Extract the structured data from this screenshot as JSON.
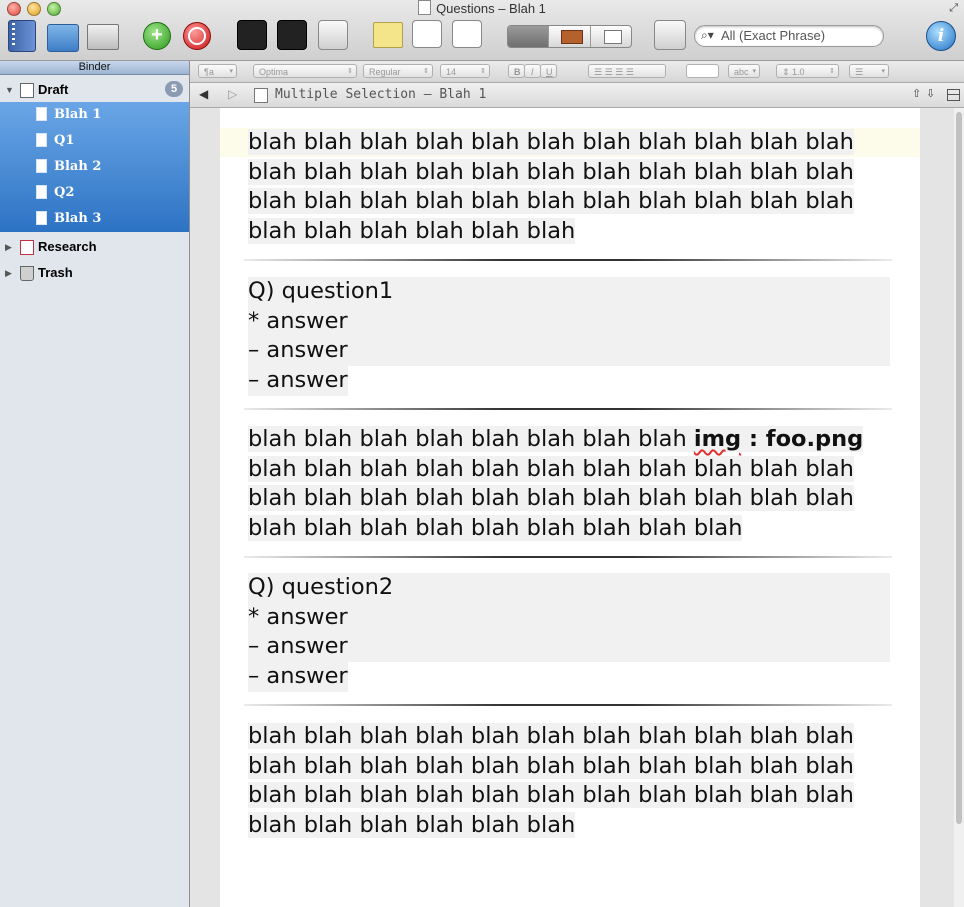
{
  "window": {
    "title": "Questions – Blah 1"
  },
  "toolbar": {
    "icons": [
      "binder-icon",
      "collections-icon",
      "corkboard-icon",
      "add-icon",
      "delete-icon",
      "compose-icon",
      "keywords-icon",
      "scrivenings-icon",
      "notes-icon",
      "inspector-view-icon",
      "snapshot-icon",
      "quick-reference-icon",
      "search-icon",
      "inspector-icon"
    ],
    "add_glyph": "+",
    "inspector_glyph": "i",
    "search": {
      "placeholder": "All (Exact Phrase)"
    }
  },
  "binder": {
    "header": "Binder",
    "draft": {
      "label": "Draft",
      "badge": "5",
      "children": [
        "Blah 1",
        "Q1",
        "Blah 2",
        "Q2",
        "Blah 3"
      ]
    },
    "research": {
      "label": "Research"
    },
    "trash": {
      "label": "Trash"
    }
  },
  "formatbar": {
    "style": "¶a",
    "font_family": "Optima",
    "font_weight": "Regular",
    "font_size": "14",
    "bold": "B",
    "italic": "I",
    "underline": "U",
    "highlight": "abc",
    "line_spacing": "1.0"
  },
  "editor": {
    "header_title": "Multiple Selection – Blah 1",
    "segment_1": [
      "blah blah blah blah blah blah blah blah blah blah blah",
      "blah blah blah blah blah blah blah blah blah blah blah",
      "blah blah blah blah blah blah blah blah blah blah blah",
      "blah blah blah blah blah blah"
    ],
    "question_1": {
      "question": "Q) question1",
      "answers": [
        "* answer",
        "– answer",
        "– answer"
      ]
    },
    "segment_3": {
      "line_1_text": "blah blah blah blah blah blah blah blah ",
      "img_word": "img",
      "img_rest": " : foo.png",
      "lines": [
        "blah blah blah blah blah blah blah blah blah blah blah",
        "blah blah blah blah blah blah blah blah blah blah blah",
        "blah blah blah blah blah blah blah blah blah"
      ]
    },
    "question_2": {
      "question": "Q) question2",
      "answers": [
        "* answer",
        "– answer",
        "– answer"
      ]
    },
    "segment_5": [
      "blah blah blah blah blah blah blah blah blah blah blah",
      "blah blah blah blah blah blah blah blah blah blah blah",
      "blah blah blah blah blah blah blah blah blah blah blah",
      "blah blah blah blah blah blah"
    ]
  }
}
